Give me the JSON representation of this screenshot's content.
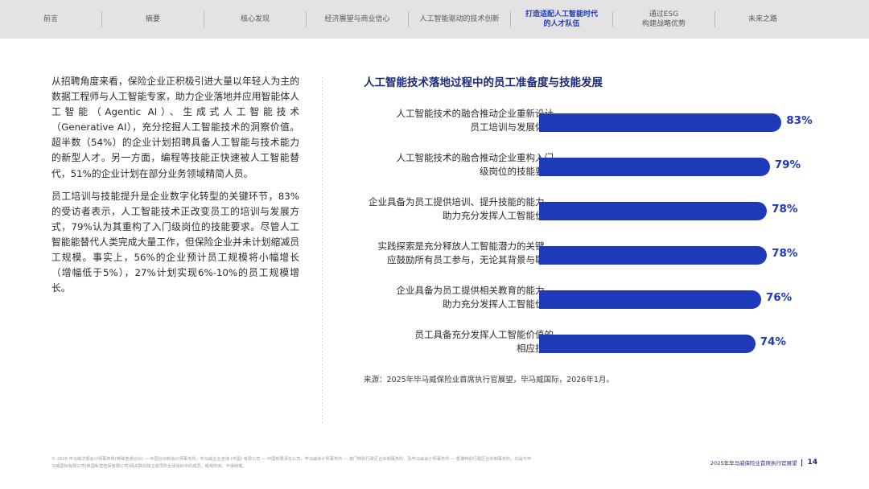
{
  "nav": {
    "tabs": [
      {
        "lines": [
          "前言"
        ],
        "active": false
      },
      {
        "lines": [
          "摘要"
        ],
        "active": false
      },
      {
        "lines": [
          "核心发现"
        ],
        "active": false
      },
      {
        "lines": [
          "经济展望与商业信心"
        ],
        "active": false
      },
      {
        "lines": [
          "人工智能驱动的技术创新"
        ],
        "active": false
      },
      {
        "lines": [
          "打造适配人工智能时代",
          "的人才队伍"
        ],
        "active": true
      },
      {
        "lines": [
          "通过ESG",
          "构建战略优势"
        ],
        "active": false
      },
      {
        "lines": [
          "未来之路"
        ],
        "active": false
      }
    ]
  },
  "body": {
    "paragraphs": [
      "从招聘角度来看，保险企业正积极引进大量以年轻人为主的数据工程师与人工智能专家，助力企业落地并应用智能体人工智能（Agentic AI）、生成式人工智能技术（Generative AI），充分挖掘人工智能技术的洞察价值。超半数（54%）的企业计划招聘具备人工智能与技术能力的新型人才。另一方面，编程等技能正快速被人工智能替代，51%的企业计划在部分业务领域精简人员。",
      "员工培训与技能提升是企业数字化转型的关键环节，83%的受访者表示，人工智能技术正改变员工的培训与发展方式，79%认为其重构了入门级岗位的技能要求。尽管人工智能能替代人类完成大量工作，但保险企业并未计划缩减员工规模。事实上，56%的企业预计员工规模将小幅增长（增幅低于5%），27%计划实现6%-10%的员工规模增长。"
    ]
  },
  "chart_data": {
    "type": "bar",
    "orientation": "horizontal",
    "title": "人工智能技术落地过程中的员工准备度与技能发展",
    "categories": [
      [
        "人工智能技术的融合推动企业重新设计",
        "员工培训与发展体系"
      ],
      [
        "人工智能技术的融合推动企业重构入门",
        "级岗位的技能要求"
      ],
      [
        "企业具备为员工提供培训、提升技能的能力，",
        "助力充分发挥人工智能价值"
      ],
      [
        "实践探索是充分释放人工智能潜力的关键，",
        "应鼓励所有员工参与，无论其背景与职级"
      ],
      [
        "企业具备为员工提供相关教育的能力，",
        "助力充分发挥人工智能价值"
      ],
      [
        "员工具备充分发挥人工智能价值的",
        "相应技能"
      ]
    ],
    "values": [
      83,
      79,
      78,
      78,
      76,
      74
    ],
    "value_labels": [
      "83%",
      "79%",
      "78%",
      "78%",
      "76%",
      "74%"
    ],
    "unit": "%",
    "bar_color": "#1e3ab8"
  },
  "source": "来源：2025年毕马威保险业首席执行官展望，毕马威国际，2026年1月。",
  "footer": {
    "legal": "© 2026 毕马威华振会计师事务所(特殊普通合伙) — 中国合伙制会计师事务所，毕马威企业咨询 (中国) 有限公司 — 中国有限责任公司，毕马威会计师事务所 — 澳门特别行政区合伙制事务所，及毕马威会计师事务所 — 香港特别行政区合伙制事务所，均是与毕马威国际有限公司(英国私营担保有限公司)相关联的独立成员所全球组织中的成员。版权所有，不得转载。",
    "report": "2025年毕马威保险业首席执行官展望",
    "page": "14"
  }
}
